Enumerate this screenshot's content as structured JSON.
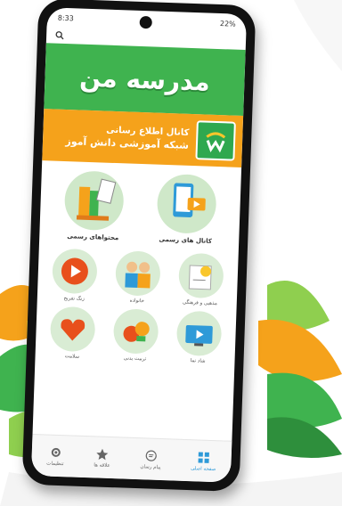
{
  "status_bar": {
    "time": "8:33",
    "battery": "22%"
  },
  "header": {
    "search_icon": "search-icon"
  },
  "brand": {
    "title": "مدرسه من"
  },
  "channel_banner": {
    "line1": "کانال اطلاع رسانی",
    "line2": "شبکه آموزشی دانش آموز"
  },
  "main_items": [
    {
      "label": "کانال های رسمی",
      "icon": "video-channel-icon"
    },
    {
      "label": "محتواهای رسمی",
      "icon": "books-icon"
    }
  ],
  "grid_items": [
    {
      "label": "مذهبی و فرهنگی",
      "icon": "pen-certificate-icon"
    },
    {
      "label": "خانواده",
      "icon": "family-icon"
    },
    {
      "label": "زنگ تفریح",
      "icon": "play-clock-icon"
    },
    {
      "label": "شاد نما",
      "icon": "tv-icon"
    },
    {
      "label": "تربیت بدنی",
      "icon": "sports-icon"
    },
    {
      "label": "سلامت",
      "icon": "heart-health-icon"
    }
  ],
  "bottom_nav": [
    {
      "label": "صفحه اصلی",
      "icon": "grid-icon",
      "active": true
    },
    {
      "label": "پیام رسان",
      "icon": "chat-icon",
      "active": false
    },
    {
      "label": "علاقه ها",
      "icon": "star-icon",
      "active": false
    },
    {
      "label": "تنظیمات",
      "icon": "gear-icon",
      "active": false
    }
  ],
  "colors": {
    "green": "#3fb34f",
    "orange": "#f5a21b",
    "nav_active": "#2e9ad8"
  }
}
